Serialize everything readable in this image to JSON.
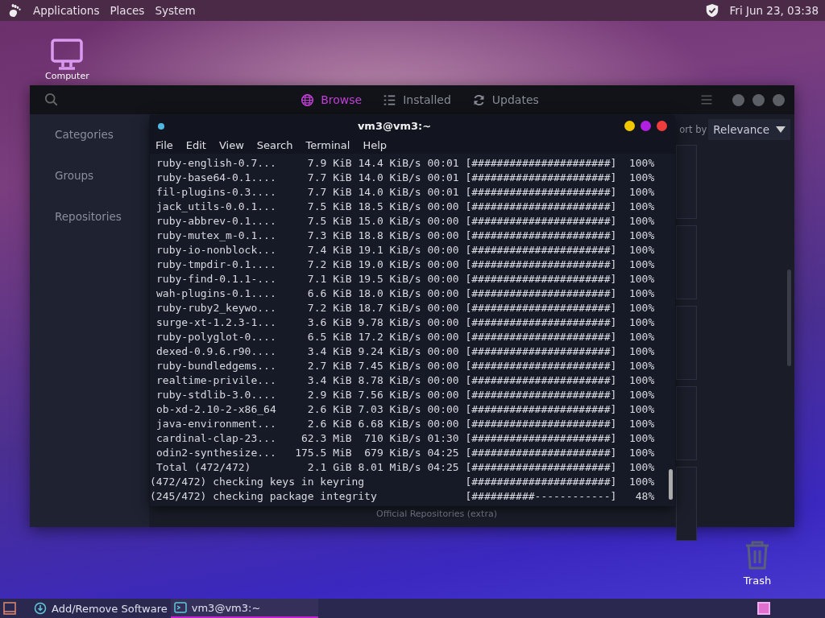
{
  "top_panel": {
    "menus": [
      "Applications",
      "Places",
      "System"
    ],
    "clock": "Fri Jun 23, 03:38"
  },
  "desktop_icons": [
    {
      "kind": "computer",
      "label": "Computer"
    },
    {
      "kind": "trash",
      "label": "Trash"
    }
  ],
  "software_window": {
    "tabs": [
      {
        "kind": "browse",
        "label": "Browse",
        "selected": true
      },
      {
        "kind": "installed",
        "label": "Installed",
        "selected": false
      },
      {
        "kind": "updates",
        "label": "Updates",
        "selected": false
      }
    ],
    "sidebar": {
      "items": [
        "Categories",
        "Groups",
        "Repositories"
      ]
    },
    "sort": {
      "label": "ort by",
      "value": "Relevance"
    },
    "footer_text": "Official Repositories (extra)"
  },
  "terminal": {
    "title": "vm3@vm3:~",
    "menu": [
      "File",
      "Edit",
      "View",
      "Search",
      "Terminal",
      "Help"
    ],
    "downloads": [
      {
        "name": "ruby-english-0.7...",
        "size": "7.9 KiB",
        "speed": "14.4 KiB/s",
        "time": "00:01",
        "bar": "[######################]",
        "percent": "100%"
      },
      {
        "name": "ruby-base64-0.1....",
        "size": "7.7 KiB",
        "speed": "14.0 KiB/s",
        "time": "00:01",
        "bar": "[######################]",
        "percent": "100%"
      },
      {
        "name": "fil-plugins-0.3....",
        "size": "7.7 KiB",
        "speed": "14.0 KiB/s",
        "time": "00:01",
        "bar": "[######################]",
        "percent": "100%"
      },
      {
        "name": "jack_utils-0.0.1...",
        "size": "7.5 KiB",
        "speed": "18.5 KiB/s",
        "time": "00:00",
        "bar": "[######################]",
        "percent": "100%"
      },
      {
        "name": "ruby-abbrev-0.1....",
        "size": "7.5 KiB",
        "speed": "15.0 KiB/s",
        "time": "00:00",
        "bar": "[######################]",
        "percent": "100%"
      },
      {
        "name": "ruby-mutex_m-0.1...",
        "size": "7.3 KiB",
        "speed": "18.8 KiB/s",
        "time": "00:00",
        "bar": "[######################]",
        "percent": "100%"
      },
      {
        "name": "ruby-io-nonblock...",
        "size": "7.4 KiB",
        "speed": "19.1 KiB/s",
        "time": "00:00",
        "bar": "[######################]",
        "percent": "100%"
      },
      {
        "name": "ruby-tmpdir-0.1....",
        "size": "7.2 KiB",
        "speed": "19.0 KiB/s",
        "time": "00:00",
        "bar": "[######################]",
        "percent": "100%"
      },
      {
        "name": "ruby-find-0.1.1-...",
        "size": "7.1 KiB",
        "speed": "19.5 KiB/s",
        "time": "00:00",
        "bar": "[######################]",
        "percent": "100%"
      },
      {
        "name": "wah-plugins-0.1....",
        "size": "6.6 KiB",
        "speed": "18.0 KiB/s",
        "time": "00:00",
        "bar": "[######################]",
        "percent": "100%"
      },
      {
        "name": "ruby-ruby2_keywo...",
        "size": "7.2 KiB",
        "speed": "18.7 KiB/s",
        "time": "00:00",
        "bar": "[######################]",
        "percent": "100%"
      },
      {
        "name": "surge-xt-1.2.3-1...",
        "size": "3.6 KiB",
        "speed": "9.78 KiB/s",
        "time": "00:00",
        "bar": "[######################]",
        "percent": "100%"
      },
      {
        "name": "ruby-polyglot-0....",
        "size": "6.5 KiB",
        "speed": "17.2 KiB/s",
        "time": "00:00",
        "bar": "[######################]",
        "percent": "100%"
      },
      {
        "name": "dexed-0.9.6.r90....",
        "size": "3.4 KiB",
        "speed": "9.24 KiB/s",
        "time": "00:00",
        "bar": "[######################]",
        "percent": "100%"
      },
      {
        "name": "ruby-bundledgems...",
        "size": "2.7 KiB",
        "speed": "7.45 KiB/s",
        "time": "00:00",
        "bar": "[######################]",
        "percent": "100%"
      },
      {
        "name": "realtime-privile...",
        "size": "3.4 KiB",
        "speed": "8.78 KiB/s",
        "time": "00:00",
        "bar": "[######################]",
        "percent": "100%"
      },
      {
        "name": "ruby-stdlib-3.0....",
        "size": "2.9 KiB",
        "speed": "7.56 KiB/s",
        "time": "00:00",
        "bar": "[######################]",
        "percent": "100%"
      },
      {
        "name": "ob-xd-2.10-2-x86_64",
        "size": "2.6 KiB",
        "speed": "7.03 KiB/s",
        "time": "00:00",
        "bar": "[######################]",
        "percent": "100%"
      },
      {
        "name": "java-environment...",
        "size": "2.6 KiB",
        "speed": "6.68 KiB/s",
        "time": "00:00",
        "bar": "[######################]",
        "percent": "100%"
      },
      {
        "name": "cardinal-clap-23...",
        "size": "62.3 MiB",
        "speed": "710 KiB/s",
        "time": "01:30",
        "bar": "[######################]",
        "percent": "100%"
      },
      {
        "name": "odin2-synthesize...",
        "size": "175.5 MiB",
        "speed": "679 KiB/s",
        "time": "04:25",
        "bar": "[######################]",
        "percent": "100%"
      },
      {
        "name": "Total (472/472)",
        "size": "2.1 GiB",
        "speed": "8.01 MiB/s",
        "time": "04:25",
        "bar": "[######################]",
        "percent": "100%"
      }
    ],
    "checks": [
      {
        "text": "(472/472) checking keys in keyring",
        "bar": "[######################]",
        "percent": "100%"
      },
      {
        "text": "(245/472) checking package integrity",
        "bar": "[##########------------]",
        "percent": "48%"
      }
    ]
  },
  "taskbar": {
    "items": [
      {
        "kind": "software",
        "label": "Add/Remove Software",
        "selected": false
      },
      {
        "kind": "terminal",
        "label": "vm3@vm3:~",
        "selected": true
      }
    ]
  }
}
